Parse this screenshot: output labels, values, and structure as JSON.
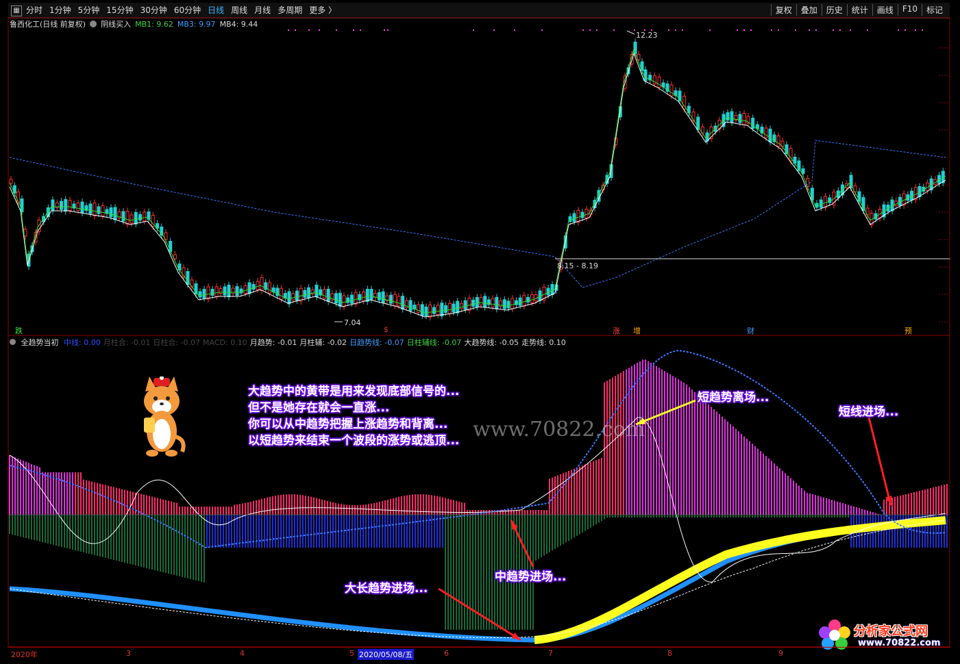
{
  "toolbar": {
    "periods": [
      "分时",
      "1分钟",
      "5分钟",
      "15分钟",
      "30分钟",
      "60分钟",
      "日线",
      "周线",
      "月线",
      "多周期",
      "更多 〉"
    ],
    "active": "日线",
    "right": [
      "复权",
      "叠加",
      "历史",
      "统计",
      "画线",
      "F10",
      "标记"
    ]
  },
  "main": {
    "stock": "鲁西化工(日线 前复权)",
    "indicator": "阴线买入",
    "mb1": "MB1: 9.62",
    "mb3": "MB3: 9.97",
    "mb4": "MB4: 9.44",
    "high_label": "12.23",
    "low_label": "7.04",
    "range_label": "8.15 - 8.19",
    "markers": [
      "跌",
      "$",
      "涨",
      "增",
      "财",
      "预"
    ]
  },
  "sub": {
    "name": "全趋势当初",
    "items": [
      {
        "label": "中线: 0.00",
        "color": "#3050ff"
      },
      {
        "label": "月柱合: -0.01",
        "color": "#444"
      },
      {
        "label": "日柱合: -0.07",
        "color": "#444"
      },
      {
        "label": "MACD: 0.10",
        "color": "#444"
      },
      {
        "label": "月趋势: -0.01",
        "color": "#ddd"
      },
      {
        "label": "月柱辅: -0.02",
        "color": "#ddd"
      },
      {
        "label": "日趋势线: -0.07",
        "color": "#40a0ff"
      },
      {
        "label": "日柱辅线: -0.07",
        "color": "#40d040"
      },
      {
        "label": "大趋势线: -0.05",
        "color": "#ddd"
      },
      {
        "label": "走势线: 0.10",
        "color": "#ddd"
      }
    ]
  },
  "annotations": {
    "note_lines": [
      "大趋势中的黄带是用来发现底部信号的...",
      "但不是她存在就会一直涨...",
      "你可以从中趋势把握上涨趋势和背离...",
      "以短趋势来结束一个波段的涨势或逃顶..."
    ],
    "short_exit": "短趋势离场...",
    "short_entry": "短线进场...",
    "mid_entry": "中趋势进场...",
    "long_entry": "大长趋势进场..."
  },
  "watermark": "www.70822.com",
  "logo": {
    "text": "分析家公式网",
    "url": "www.70822.com"
  },
  "axis": {
    "labels": [
      "2020年",
      "3",
      "4",
      "5",
      "2020/05/08/五",
      "6",
      "7",
      "8",
      "9"
    ]
  }
}
